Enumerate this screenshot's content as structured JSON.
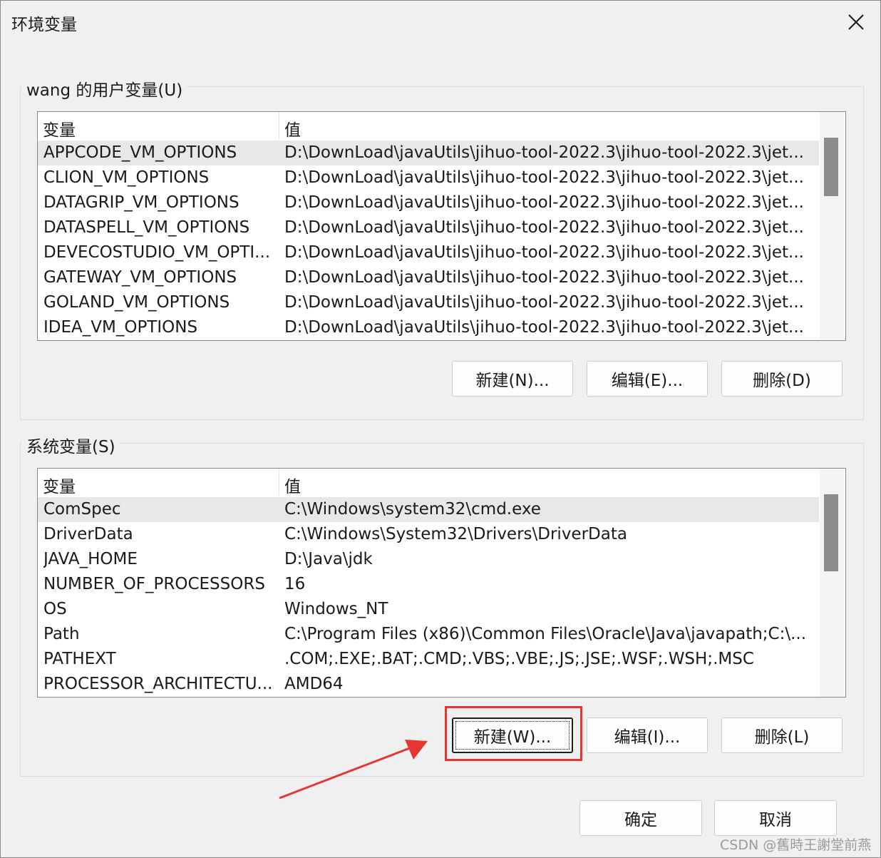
{
  "window": {
    "title": "环境变量",
    "close_icon": "close-icon"
  },
  "user_section": {
    "label": "wang 的用户变量(U)",
    "headers": [
      "变量",
      "值"
    ],
    "rows": [
      {
        "name": "APPCODE_VM_OPTIONS",
        "value": "D:\\DownLoad\\javaUtils\\jihuo-tool-2022.3\\jihuo-tool-2022.3\\jet...",
        "selected": true
      },
      {
        "name": "CLION_VM_OPTIONS",
        "value": "D:\\DownLoad\\javaUtils\\jihuo-tool-2022.3\\jihuo-tool-2022.3\\jet..."
      },
      {
        "name": "DATAGRIP_VM_OPTIONS",
        "value": "D:\\DownLoad\\javaUtils\\jihuo-tool-2022.3\\jihuo-tool-2022.3\\jet..."
      },
      {
        "name": "DATASPELL_VM_OPTIONS",
        "value": "D:\\DownLoad\\javaUtils\\jihuo-tool-2022.3\\jihuo-tool-2022.3\\jet..."
      },
      {
        "name": "DEVECOSTUDIO_VM_OPTI...",
        "value": "D:\\DownLoad\\javaUtils\\jihuo-tool-2022.3\\jihuo-tool-2022.3\\jet..."
      },
      {
        "name": "GATEWAY_VM_OPTIONS",
        "value": "D:\\DownLoad\\javaUtils\\jihuo-tool-2022.3\\jihuo-tool-2022.3\\jet..."
      },
      {
        "name": "GOLAND_VM_OPTIONS",
        "value": "D:\\DownLoad\\javaUtils\\jihuo-tool-2022.3\\jihuo-tool-2022.3\\jet..."
      },
      {
        "name": "IDEA_VM_OPTIONS",
        "value": "D:\\DownLoad\\javaUtils\\jihuo-tool-2022.3\\jihuo-tool-2022.3\\jet..."
      }
    ],
    "buttons": {
      "new": "新建(N)...",
      "edit": "编辑(E)...",
      "delete": "删除(D)"
    }
  },
  "system_section": {
    "label": "系统变量(S)",
    "headers": [
      "变量",
      "值"
    ],
    "rows": [
      {
        "name": "ComSpec",
        "value": "C:\\Windows\\system32\\cmd.exe",
        "selected": true
      },
      {
        "name": "DriverData",
        "value": "C:\\Windows\\System32\\Drivers\\DriverData"
      },
      {
        "name": "JAVA_HOME",
        "value": "D:\\Java\\jdk"
      },
      {
        "name": "NUMBER_OF_PROCESSORS",
        "value": "16"
      },
      {
        "name": "OS",
        "value": "Windows_NT"
      },
      {
        "name": "Path",
        "value": "C:\\Program Files (x86)\\Common Files\\Oracle\\Java\\javapath;C:\\..."
      },
      {
        "name": "PATHEXT",
        "value": ".COM;.EXE;.BAT;.CMD;.VBS;.VBE;.JS;.JSE;.WSF;.WSH;.MSC"
      },
      {
        "name": "PROCESSOR_ARCHITECTU...",
        "value": "AMD64"
      }
    ],
    "buttons": {
      "new": "新建(W)...",
      "edit": "编辑(I)...",
      "delete": "删除(L)"
    }
  },
  "footer": {
    "ok": "确定",
    "cancel": "取消"
  },
  "annotation": {
    "color": "#e63631"
  },
  "watermark": "CSDN @舊時王謝堂前燕"
}
